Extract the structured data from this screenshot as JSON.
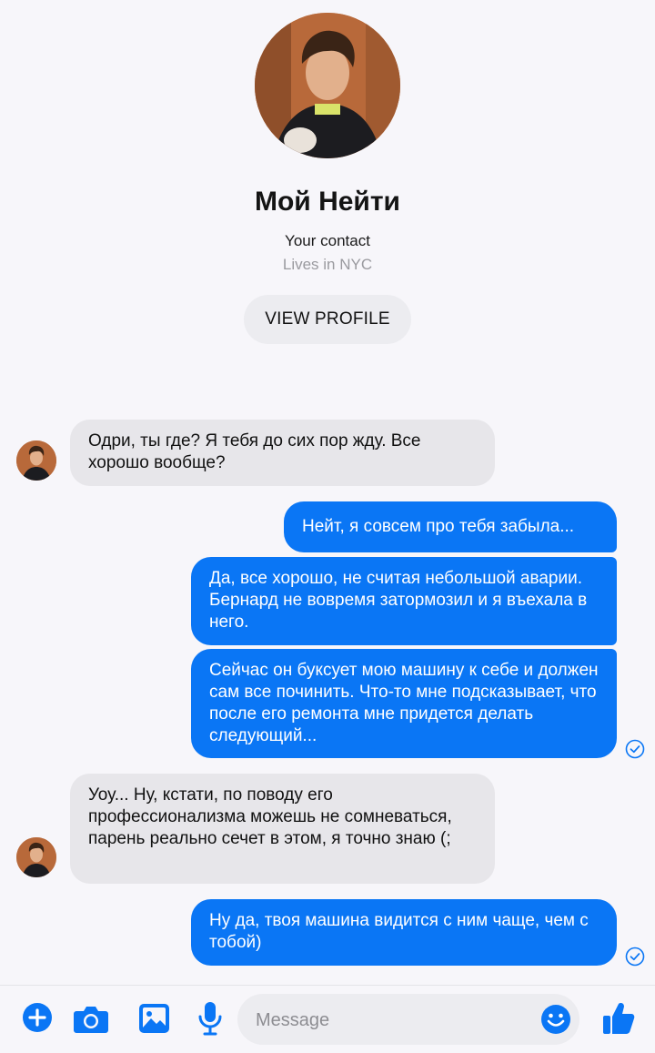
{
  "contact": {
    "name": "Мой Нейти",
    "relation": "Your contact",
    "location": "Lives in NYC",
    "view_profile_label": "VIEW PROFILE"
  },
  "messages": [
    {
      "direction": "incoming",
      "text": "Одри, ты где? Я тебя до сих пор жду. Все хорошо вообще?"
    },
    {
      "direction": "outgoing",
      "text": "Нейт, я совсем про тебя забыла..."
    },
    {
      "direction": "outgoing",
      "text": "Да, все хорошо, не считая небольшой аварии. Бернард не вовремя затормозил и я въехала в него."
    },
    {
      "direction": "outgoing",
      "text": "Сейчас он буксует мою машину к себе и должен сам все починить. Что-то мне подсказывает, что после его ремонта мне придется делать следующий..."
    },
    {
      "direction": "incoming",
      "text": "Уоу... Ну, кстати, по поводу его профессионализма можешь не сомневаться, парень реально сечет в этом, я точно знаю (;"
    },
    {
      "direction": "outgoing",
      "text": "Ну да, твоя машина видится с ним чаще, чем с тобой)"
    }
  ],
  "composer": {
    "placeholder": "Message"
  },
  "icons": {
    "plus": "plus-circle-icon",
    "camera": "camera-icon",
    "gallery": "image-icon",
    "mic": "microphone-icon",
    "emoji": "smiley-icon",
    "like": "thumbs-up-icon",
    "seen": "check-circle-icon"
  },
  "colors": {
    "accent": "#0a76f5",
    "incoming_bubble": "#e7e6ea",
    "background": "#f7f6fa"
  }
}
